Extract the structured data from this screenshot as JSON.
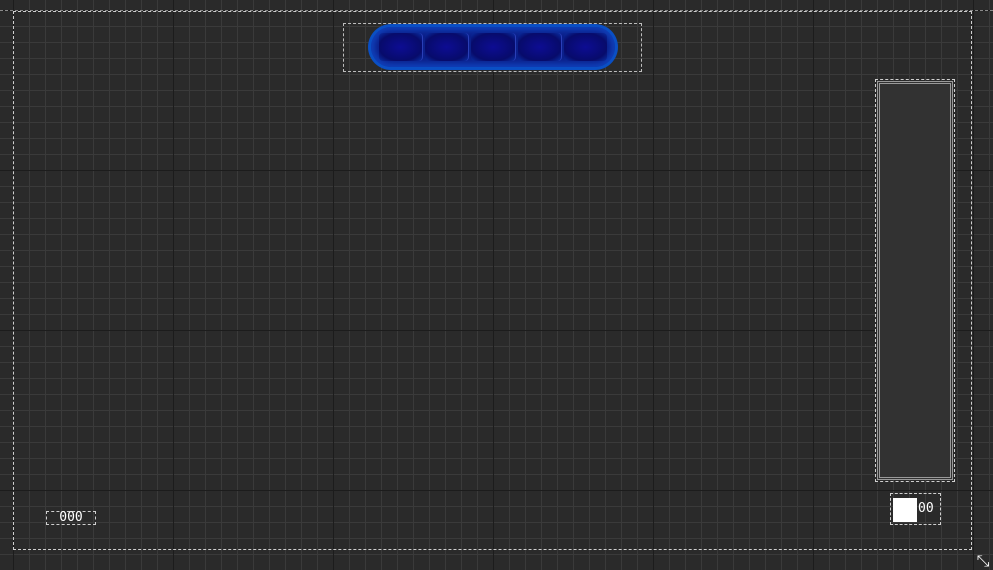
{
  "score": {
    "value": "000"
  },
  "counter": {
    "value": "00",
    "swatch_color": "#ffffff"
  },
  "progress": {
    "segments": 5,
    "fill_color": "#0b1f8a",
    "border_color": "#0a4fc4"
  },
  "resize_handle": {
    "glyph": "⤡",
    "icon": "resize-icon"
  },
  "colors": {
    "background": "#2a2a2a",
    "grid_minor": "#3a3a3a",
    "grid_major": "#1c1c1c",
    "frame_dash": "#cfcfcf"
  }
}
